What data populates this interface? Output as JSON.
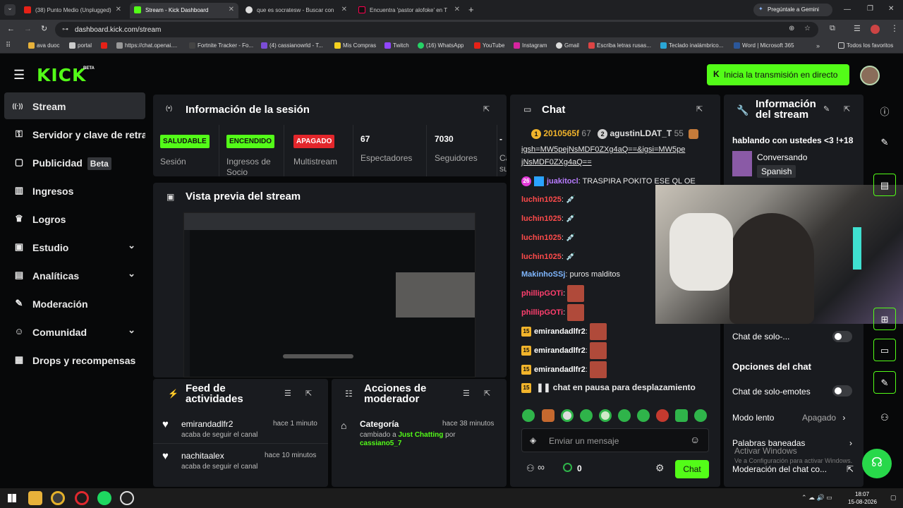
{
  "browser": {
    "tabs": [
      {
        "title": "(38) Punto Medio (Unplugged)",
        "active": false
      },
      {
        "title": "Stream - Kick Dashboard",
        "active": true
      },
      {
        "title": "que es socratesw - Buscar con",
        "active": false
      },
      {
        "title": "Encuentra 'pastor alofoke' en T",
        "active": false
      }
    ],
    "gemini_label": "Pregúntale a Gemini",
    "url": "dashboard.kick.com/stream",
    "bookmarks": [
      "ava duoc",
      "portal",
      "https://chat.openai....",
      "Fortnite Tracker - Fo...",
      "(4) cassianowrld - T...",
      "Mis Compras",
      "Twitch",
      "(16) WhatsApp",
      "YouTube",
      "Instagram",
      "Gmail",
      "Escriba letras rusas...",
      "Teclado inalámbrico...",
      "Word | Microsoft 365"
    ],
    "all_favorites": "Todos los favoritos"
  },
  "header": {
    "logo": "KICK",
    "logo_beta": "BETA",
    "live_button": "Inicia la transmisión en directo"
  },
  "sidebar": {
    "items": [
      {
        "label": "Stream",
        "icon": "broadcast-icon",
        "glyph": "((·))",
        "active": true
      },
      {
        "label": "Servidor y clave de retransmisión",
        "icon": "key-icon",
        "glyph": "⚿"
      },
      {
        "label": "Publicidad",
        "icon": "ad-icon",
        "glyph": "▢",
        "tag": "Beta"
      },
      {
        "label": "Ingresos",
        "icon": "chart-icon",
        "glyph": "▥"
      },
      {
        "label": "Logros",
        "icon": "trophy-icon",
        "glyph": "♛"
      },
      {
        "label": "Estudio",
        "icon": "studio-icon",
        "glyph": "▣",
        "expand": true
      },
      {
        "label": "Analíticas",
        "icon": "analytics-icon",
        "glyph": "▤",
        "expand": true
      },
      {
        "label": "Moderación",
        "icon": "wrench-icon",
        "glyph": "✎"
      },
      {
        "label": "Comunidad",
        "icon": "community-icon",
        "glyph": "☺",
        "expand": true
      },
      {
        "label": "Drops y recompensas",
        "icon": "gift-icon",
        "glyph": "▦"
      }
    ]
  },
  "session": {
    "title": "Información de la sesión",
    "stats": [
      {
        "badge": "SALUDABLE",
        "badge_color": "#53fc18",
        "label": "Sesión"
      },
      {
        "badge": "ENCENDIDO",
        "badge_color": "#53fc18",
        "label": "Ingresos de Socio"
      },
      {
        "badge": "APAGADO",
        "badge_color": "#e3262b",
        "label": "Multistream"
      },
      {
        "value": "67",
        "label": "Espectadores"
      },
      {
        "value": "7030",
        "label": "Seguidores"
      },
      {
        "value": "-",
        "label": "Ca su"
      }
    ]
  },
  "preview": {
    "title": "Vista previa del stream"
  },
  "feed": {
    "title": "Feed de actividades",
    "items": [
      {
        "user": "emirandadlfr2",
        "time": "hace 1 minuto",
        "text": "acaba de seguir el canal"
      },
      {
        "user": "nachitaalex",
        "time": "hace 10 minutos",
        "text": "acaba de seguir el canal"
      }
    ]
  },
  "modactions": {
    "title": "Acciones de moderador",
    "items": [
      {
        "action": "Categoría",
        "time": "hace 38 minutos",
        "prefix": "cambiado a ",
        "value": "Just Chatting",
        "mid": " por ",
        "by": "cassiano5_7"
      }
    ]
  },
  "chat": {
    "title": "Chat",
    "top": [
      {
        "rank": "1",
        "user": "2010565f",
        "count": "67"
      },
      {
        "rank": "2",
        "user": "agustinLDAT_T",
        "count": "55"
      }
    ],
    "link_line1": "igsh=MW5pejNsMDF0ZXg4aQ==&igsi=MW5pe",
    "link_line2": "jNsMDF0ZXg4aQ==",
    "messages": [
      {
        "sub": "26",
        "user": "juakitocl",
        "color": "#b87cff",
        "text": "TRASPIRA POKITO ESE QL OE"
      },
      {
        "user": "luchin1025",
        "color": "#ff4b4b",
        "text": ""
      },
      {
        "user": "luchin1025",
        "color": "#ff4b4b",
        "text": ""
      },
      {
        "user": "luchin1025",
        "color": "#ff4b4b",
        "text": ""
      },
      {
        "user": "luchin1025",
        "color": "#ff4b4b",
        "text": ""
      },
      {
        "user": "MakinhoSSj",
        "color": "#7fb7ff",
        "text": "puros malditos"
      },
      {
        "user": "phillipGOTi",
        "color": "#ff3f6e",
        "text": ""
      },
      {
        "user": "phillipGOTi",
        "color": "#ff3f6e",
        "text": ""
      },
      {
        "sub": "15",
        "user": "emirandadlfr2",
        "color": "#ffffff",
        "text": ""
      },
      {
        "sub": "15",
        "user": "emirandadlfr2",
        "color": "#ffffff",
        "text": ""
      },
      {
        "sub": "15",
        "user": "emirandadlfr2",
        "color": "#ffffff",
        "text": ""
      }
    ],
    "paused": "chat en pausa para desplazamiento",
    "input_placeholder": "Enviar un mensaje",
    "points": "0",
    "send_label": "Chat"
  },
  "streaminfo": {
    "title": "Información del stream",
    "stream_title": "hablando con ustedes <3 !+18",
    "category": "Conversando",
    "language": "Spanish",
    "sub_only": "Chat de solo-...",
    "chat_options": "Opciones del chat",
    "emote_only": "Chat de solo-emotes",
    "slow_mode": "Modo lento",
    "slow_value": "Apagado",
    "banned_words": "Palabras baneadas",
    "chat_mod": "Moderación del chat co...",
    "windows_activate": "Activar Windows",
    "windows_hint": "Ve a Configuración para activar Windows."
  },
  "taskbar": {
    "time": "18:07",
    "date": "15-08-2026"
  }
}
